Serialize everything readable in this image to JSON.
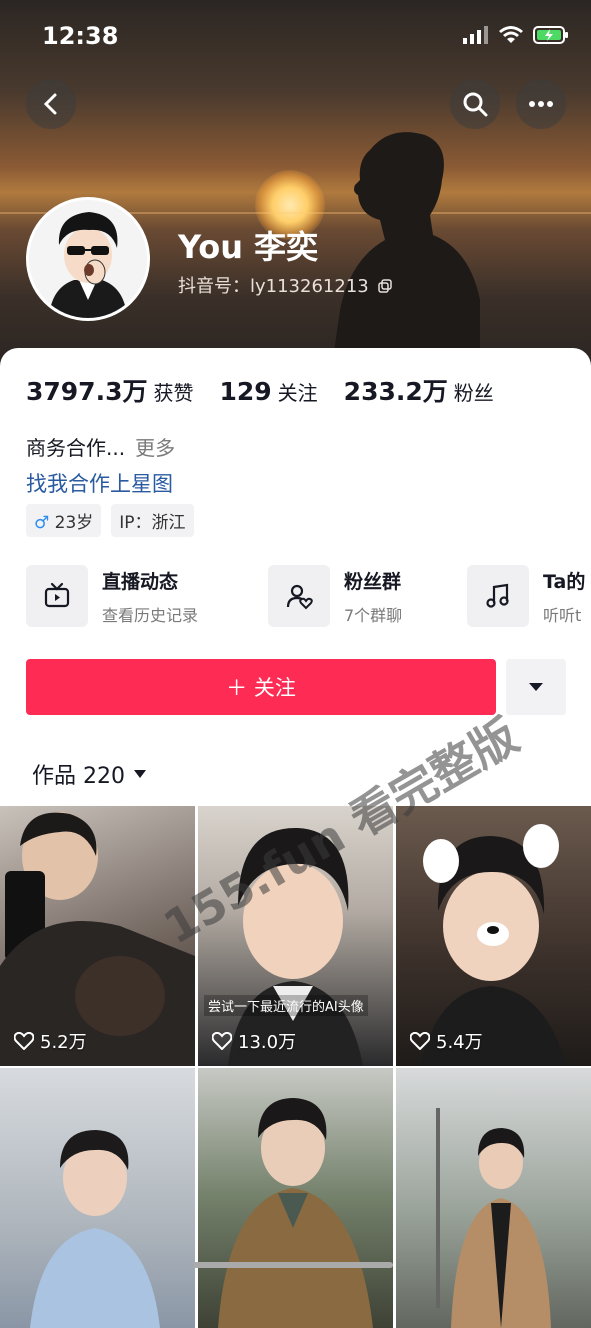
{
  "status_bar": {
    "time": "12:38"
  },
  "profile": {
    "name": "You 李奕",
    "douyin_id": "抖音号：ly113261213",
    "likes_count": "3797.3万",
    "likes_label": "获赞",
    "following_count": "129",
    "following_label": "关注",
    "followers_count": "233.2万",
    "followers_label": "粉丝",
    "bio": "商务合作...",
    "bio_more": "更多",
    "star_link": "找我合作上星图",
    "tag_age": "23岁",
    "tag_gender_symbol": "♂",
    "tag_ip": "IP：浙江"
  },
  "features": [
    {
      "title": "直播动态",
      "subtitle": "查看历史记录",
      "icon": "tv-icon"
    },
    {
      "title": "粉丝群",
      "subtitle": "7个群聊",
      "icon": "fan-group-icon"
    },
    {
      "title": "Ta的",
      "subtitle": "听听t",
      "icon": "music-note-icon"
    }
  ],
  "actions": {
    "follow_label": "＋ 关注"
  },
  "works": {
    "label": "作品 220"
  },
  "videos": [
    {
      "likes": "5.2万",
      "caption": ""
    },
    {
      "likes": "13.0万",
      "caption": "尝试一下最近流行的AI头像"
    },
    {
      "likes": "5.4万",
      "caption": ""
    },
    {
      "likes": "",
      "caption": ""
    },
    {
      "likes": "",
      "caption": ""
    },
    {
      "likes": "",
      "caption": ""
    }
  ],
  "watermark": "155.fun 看完整版",
  "colors": {
    "follow": "#fe2c55",
    "link": "#2a5aa0",
    "male": "#2d8cf0"
  }
}
